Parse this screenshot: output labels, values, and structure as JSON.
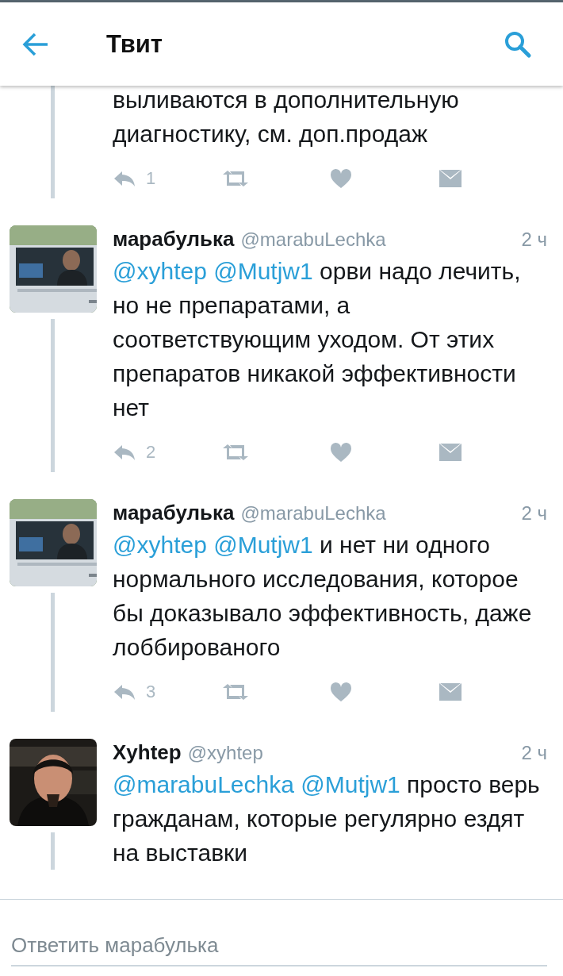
{
  "header": {
    "title": "Твит"
  },
  "tweets": [
    {
      "text": "выливаются в дополнительную диагностику, см. доп.продаж",
      "reply_count": "1"
    },
    {
      "name": "марабулька",
      "handle": "@marabuLechka",
      "time": "2 ч",
      "mentions": [
        "@xyhtep",
        "@Mutjw1"
      ],
      "text": "орви надо лечить, но не препаратами, а соответствующим уходом. От этих препаратов никакой эффективности нет",
      "reply_count": "2"
    },
    {
      "name": "марабулька",
      "handle": "@marabuLechka",
      "time": "2 ч",
      "mentions": [
        "@xyhtep",
        "@Mutjw1"
      ],
      "text": "и нет ни одного нормального исследования, которое бы доказывало эффективность, даже лоббированого",
      "reply_count": "3"
    },
    {
      "name": "Xyhtep",
      "handle": "@xyhtep",
      "time": "2 ч",
      "mentions": [
        "@marabuLechka",
        "@Mutjw1"
      ],
      "text": "просто верь гражданам, которые регулярно ездят на выставки"
    }
  ],
  "reply_bar": {
    "placeholder": "Ответить марабулька"
  }
}
